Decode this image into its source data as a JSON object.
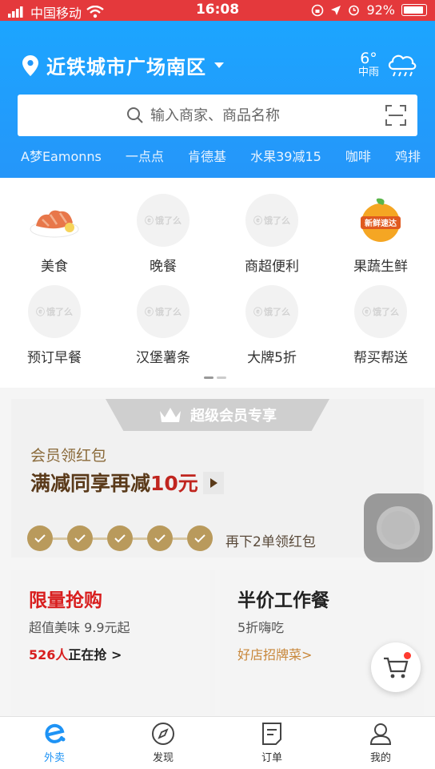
{
  "status_bar": {
    "carrier": "中国移动",
    "time": "16:08",
    "battery": "92%"
  },
  "header": {
    "location": "近铁城市广场南区",
    "weather": {
      "temp": "6°",
      "desc": "中雨"
    },
    "search_placeholder": "输入商家、商品名称",
    "hot_keywords": [
      "A梦Eamonns",
      "一点点",
      "肯德基",
      "水果39减15",
      "咖啡",
      "鸡排"
    ]
  },
  "categories": [
    {
      "label": "美食",
      "icon": "food-icon"
    },
    {
      "label": "晚餐",
      "icon": "eleme-logo-icon"
    },
    {
      "label": "商超便利",
      "icon": "eleme-logo-icon"
    },
    {
      "label": "果蔬生鲜",
      "icon": "fruit-icon"
    },
    {
      "label": "预订早餐",
      "icon": "eleme-logo-icon"
    },
    {
      "label": "汉堡薯条",
      "icon": "eleme-logo-icon"
    },
    {
      "label": "大牌5折",
      "icon": "eleme-logo-icon"
    },
    {
      "label": "帮买帮送",
      "icon": "eleme-logo-icon"
    }
  ],
  "placeholder_logo_text": "饿了么",
  "fruit_badge_text": "新鲜速达",
  "member": {
    "tab": "超级会员专享",
    "subtitle": "会员领红包",
    "title_prefix": "满减同享再减",
    "title_amount": "10元",
    "hint": "再下2单领红包",
    "checks_count": 5
  },
  "promos": [
    {
      "title": "限量抢购",
      "subtitle": "超值美味 9.9元起",
      "link_strong": "526人",
      "link_rest": "正在抢 >",
      "title_color": "#d81e1e",
      "strong_color": "#d81e1e"
    },
    {
      "title": "半价工作餐",
      "subtitle": "5折嗨吃",
      "link_strong": "",
      "link_rest": "好店招牌菜>",
      "title_color": "#222222",
      "link_color": "#c8873a"
    }
  ],
  "tabs": [
    {
      "label": "外卖",
      "icon": "takeout-icon",
      "active": true
    },
    {
      "label": "发现",
      "icon": "compass-icon",
      "active": false
    },
    {
      "label": "订单",
      "icon": "order-icon",
      "active": false
    },
    {
      "label": "我的",
      "icon": "profile-icon",
      "active": false
    }
  ],
  "colors": {
    "accent": "#1e93f5",
    "status_bar": "#e4393c",
    "gold": "#b99a5c",
    "red": "#d81e1e"
  }
}
